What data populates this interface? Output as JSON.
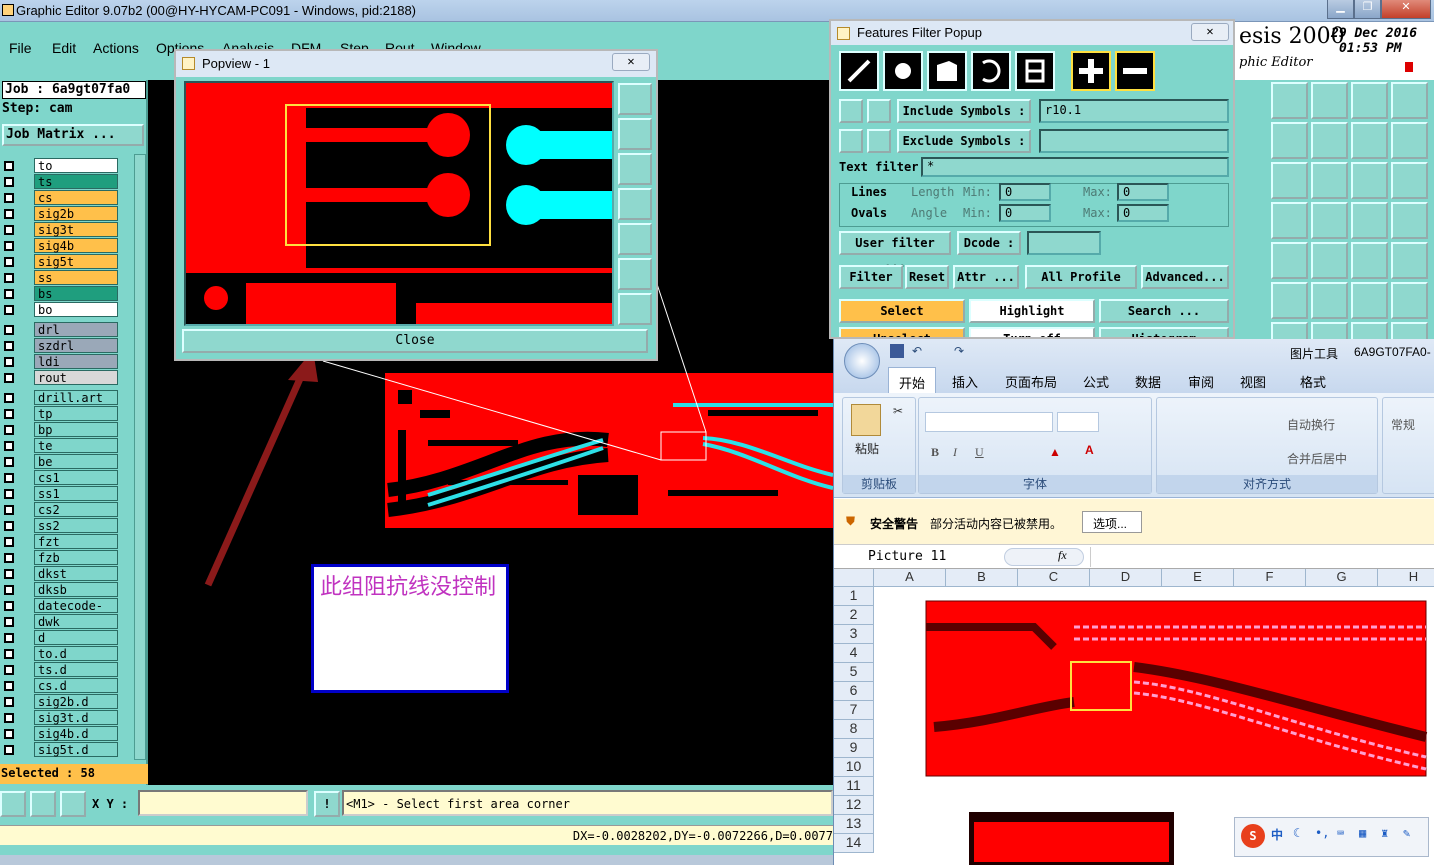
{
  "window": {
    "title": "Graphic Editor 9.07b2 (00@HY-HYCAM-PC091 - Windows, pid:2188)"
  },
  "menu": [
    "File",
    "Edit",
    "Actions",
    "Options",
    "Analysis",
    "DFM",
    "Step",
    "Rout",
    "Window"
  ],
  "job": {
    "job_label": "Job : 6a9gt07fa0",
    "step_label": "Step: cam",
    "matrix_button": "Job Matrix ..."
  },
  "layers_group1": [
    {
      "name": "to",
      "color": "#ffffff"
    },
    {
      "name": "ts",
      "color": "#1f9e7e"
    },
    {
      "name": "cs",
      "color": "#ffc04a"
    },
    {
      "name": "sig2b",
      "color": "#ffc04a"
    },
    {
      "name": "sig3t",
      "color": "#ffc04a"
    },
    {
      "name": "sig4b",
      "color": "#ffc04a"
    },
    {
      "name": "sig5t",
      "color": "#ffc04a"
    },
    {
      "name": "ss",
      "color": "#ffc04a"
    },
    {
      "name": "bs",
      "color": "#1f9e7e"
    },
    {
      "name": "bo",
      "color": "#ffffff"
    }
  ],
  "layers_group2": [
    {
      "name": "drl",
      "color": "#9aa8b8"
    },
    {
      "name": "szdrl",
      "color": "#9aa8b8"
    },
    {
      "name": "ldi",
      "color": "#9aa8b8"
    },
    {
      "name": "rout",
      "color": "#d8d8d8"
    }
  ],
  "layers_group3": [
    "drill.art",
    "tp",
    "bp",
    "te",
    "be",
    "cs1",
    "ss1",
    "cs2",
    "ss2",
    "fzt",
    "fzb",
    "dkst",
    "dksb",
    "datecode-pte",
    "dwk",
    "d",
    "to.d",
    "ts.d",
    "cs.d",
    "sig2b.d",
    "sig3t.d",
    "sig4b.d",
    "sig5t.d"
  ],
  "selected_text": "Selected : 58",
  "popview": {
    "title": "Popview - 1",
    "close_label": "Close"
  },
  "annotation": {
    "text": "此组阻抗线没控制"
  },
  "features_filter": {
    "title": "Features Filter Popup",
    "include_label": "Include Symbols :",
    "include_value": "r10.1",
    "exclude_label": "Exclude Symbols :",
    "text_filter_label": "Text filter",
    "text_filter_value": "*",
    "lines_label": "Lines",
    "ovals_label": "Ovals",
    "length_label": "Length",
    "angle_label": "Angle",
    "min_label": "Min:",
    "max_label": "Max:",
    "zero": "0",
    "user_filter": "User filter ...",
    "dcode": "Dcode :",
    "filter": "Filter",
    "reset": "Reset",
    "attr": "Attr ...",
    "all_profile": "All Profile",
    "advanced": "Advanced...",
    "select": "Select",
    "highlight": "Highlight",
    "search": "Search ...",
    "unselect": "Unselect",
    "turn_off": "Turn off",
    "histogram": "Histogram"
  },
  "brand": {
    "name": "esis 2000",
    "sub": "phic Editor",
    "date": "29 Dec 2016",
    "time": "01:53 PM"
  },
  "bottom": {
    "xy_label": "X Y :",
    "prompt": "<M1> - Select first area corner",
    "coords": "DX=-0.0028202,DY=-0.0072266,D=0.0077"
  },
  "excel": {
    "tool_title": "图片工具",
    "doc_title": "6A9GT07FA0-",
    "tabs": [
      "开始",
      "插入",
      "页面布局",
      "公式",
      "数据",
      "审阅",
      "视图",
      "格式"
    ],
    "groups": [
      "剪贴板",
      "字体",
      "对齐方式"
    ],
    "paste": "粘贴",
    "wrap": "自动换行",
    "merge": "合并后居中",
    "general": "常规",
    "security_label": "安全警告",
    "security_msg": "部分活动内容已被禁用。",
    "options_btn": "选项...",
    "namebox": "Picture 11",
    "fx": "fx",
    "columns": [
      "A",
      "B",
      "C",
      "D",
      "E",
      "F",
      "G",
      "H"
    ],
    "rows": [
      "1",
      "2",
      "3",
      "4",
      "5",
      "6",
      "7",
      "8",
      "9",
      "10",
      "11",
      "12",
      "13",
      "14"
    ]
  },
  "ime": {
    "logo": "S",
    "lang": "中"
  }
}
